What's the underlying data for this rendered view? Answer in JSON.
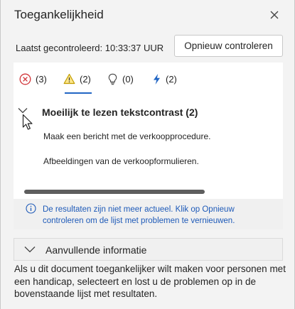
{
  "pane": {
    "title": "Toegankelijkheid",
    "last_checked": "Laatst gecontroleerd: 10:33:37 UUR",
    "recheck_label": "Opnieuw controleren"
  },
  "tabs": [
    {
      "icon": "error-icon",
      "count": "(3)"
    },
    {
      "icon": "warning-icon",
      "count": "(2)"
    },
    {
      "icon": "tip-icon",
      "count": "(0)"
    },
    {
      "icon": "intelligent-service-icon",
      "count": "(2)"
    }
  ],
  "group": {
    "title": "Moeilijk te lezen tekstcontrast (2)",
    "items": [
      "Maak een bericht met de verkoopprocedure.",
      "Afbeeldingen van de verkoopformulieren."
    ]
  },
  "notice": "De resultaten zijn niet meer actueel. Klik op Opnieuw controleren om de lijst met problemen te vernieuwen.",
  "additional": {
    "label": "Aanvullende informatie"
  },
  "footer": "Als u dit document toegankelijker wilt maken voor personen met een handicap, selecteert en lost u de problemen op in de bovenstaande lijst met resultaten.",
  "colors": {
    "accent": "#2266c4",
    "error": "#d13438",
    "warning": "#c19c00",
    "link": "#1e5ab8"
  }
}
